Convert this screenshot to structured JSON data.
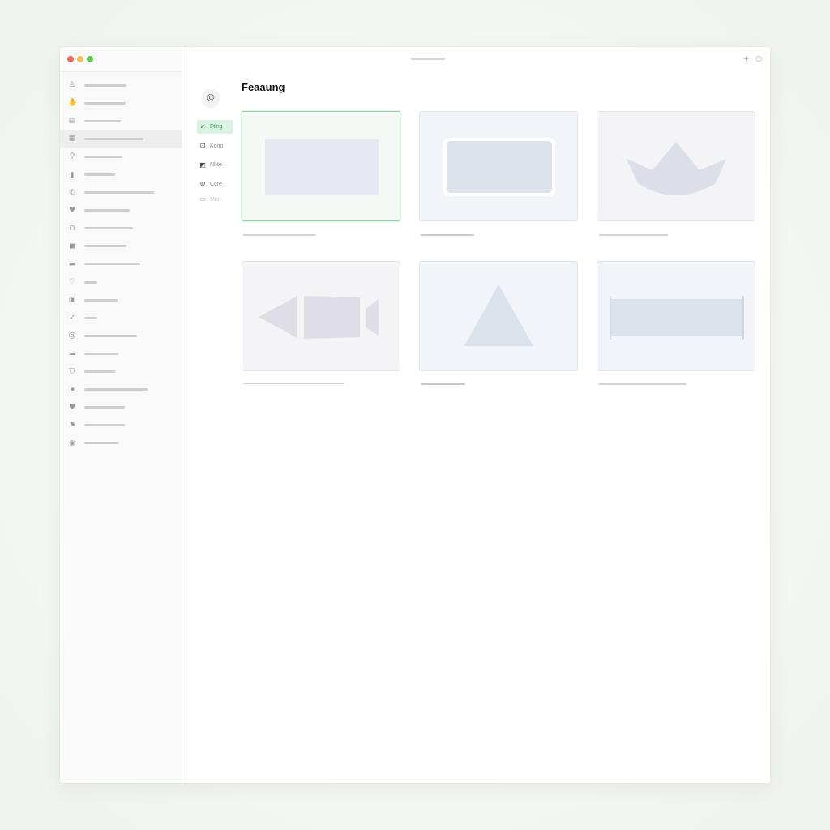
{
  "window": {
    "controls": [
      "close",
      "minimize",
      "zoom"
    ],
    "top_actions": [
      "+",
      "○"
    ]
  },
  "sidebar": {
    "items": [
      {
        "icon": "person-icon",
        "glyph": "♙",
        "active": false
      },
      {
        "icon": "hand-icon",
        "glyph": "✋",
        "active": false
      },
      {
        "icon": "inbox-icon",
        "glyph": "▤",
        "active": false
      },
      {
        "icon": "document-icon",
        "glyph": "▦",
        "active": true
      },
      {
        "icon": "search-person-icon",
        "glyph": "⚲",
        "active": false
      },
      {
        "icon": "lock-icon",
        "glyph": "▮",
        "active": false
      },
      {
        "icon": "phone-icon",
        "glyph": "✆",
        "active": false
      },
      {
        "icon": "heart-icon",
        "glyph": "♥",
        "active": false
      },
      {
        "icon": "bookmark-icon",
        "glyph": "⊓",
        "active": false
      },
      {
        "icon": "bag-icon",
        "glyph": "◼",
        "active": false
      },
      {
        "icon": "card-icon",
        "glyph": "▬",
        "active": false
      },
      {
        "icon": "heart-outline-icon",
        "glyph": "♡",
        "active": false
      },
      {
        "icon": "image-icon",
        "glyph": "▣",
        "active": false
      },
      {
        "icon": "bird-icon",
        "glyph": "➶",
        "active": false
      },
      {
        "icon": "at-icon",
        "glyph": "@",
        "active": false
      },
      {
        "icon": "cloud-icon",
        "glyph": "☁",
        "active": false
      },
      {
        "icon": "shield-icon",
        "glyph": "⛉",
        "active": false
      },
      {
        "icon": "grid-icon",
        "glyph": "▪",
        "active": false
      },
      {
        "icon": "badge-icon",
        "glyph": "⛊",
        "active": false
      },
      {
        "icon": "flag-icon",
        "glyph": "⚑",
        "active": false
      },
      {
        "icon": "location-icon",
        "glyph": "◉",
        "active": false
      }
    ]
  },
  "subnav": {
    "avatar_glyph": "@",
    "items": [
      {
        "label": "Fting",
        "glyph": "✓",
        "icon": "check-icon",
        "active": true
      },
      {
        "label": "Kono",
        "glyph": "⊡",
        "icon": "frame-icon",
        "active": false
      },
      {
        "label": "Nhte",
        "glyph": "◩",
        "icon": "note-icon",
        "active": false
      },
      {
        "label": "Ccre",
        "glyph": "⊚",
        "icon": "circle-icon",
        "active": false
      },
      {
        "label": "Mno",
        "glyph": "▭",
        "icon": "box-icon",
        "active": false
      }
    ]
  },
  "main": {
    "title": "Feaaung",
    "cards": [
      {
        "name": "card-rectangle",
        "selected": true
      },
      {
        "name": "card-rounded-rectangle",
        "selected": false
      },
      {
        "name": "card-crown",
        "selected": false
      },
      {
        "name": "card-arrow-shapes",
        "selected": false
      },
      {
        "name": "card-triangle",
        "selected": false
      },
      {
        "name": "card-bar",
        "selected": false
      }
    ]
  },
  "colors": {
    "accent_green": "#61c554",
    "selected_border": "#8fd4a6",
    "selected_badge": "#d9f2e1"
  }
}
